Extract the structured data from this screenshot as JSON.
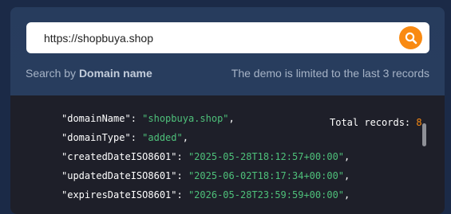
{
  "search": {
    "value": "https://shopbuya.shop",
    "placeholder": "",
    "button_icon": "search-icon",
    "accent_color": "#f98a12"
  },
  "hint": {
    "prefix": "Search by ",
    "emphasis": "Domain name",
    "limit_note": "The demo is limited to the last 3 records"
  },
  "results": {
    "total_label": "Total records: ",
    "total_value": "8",
    "lines": [
      {
        "key": "\"domainName\"",
        "sep": ": ",
        "value": "\"shopbuya.shop\"",
        "tail": ","
      },
      {
        "key": "\"domainType\"",
        "sep": ": ",
        "value": "\"added\"",
        "tail": ","
      },
      {
        "key": "\"createdDateISO8601\"",
        "sep": ": ",
        "value": "\"2025-05-28T18:12:57+00:00\"",
        "tail": ","
      },
      {
        "key": "\"updatedDateISO8601\"",
        "sep": ": ",
        "value": "\"2025-06-02T18:17:34+00:00\"",
        "tail": ","
      },
      {
        "key": "\"expiresDateISO8601\"",
        "sep": ": ",
        "value": "\"2026-05-28T23:59:59+00:00\"",
        "tail": ","
      }
    ]
  }
}
